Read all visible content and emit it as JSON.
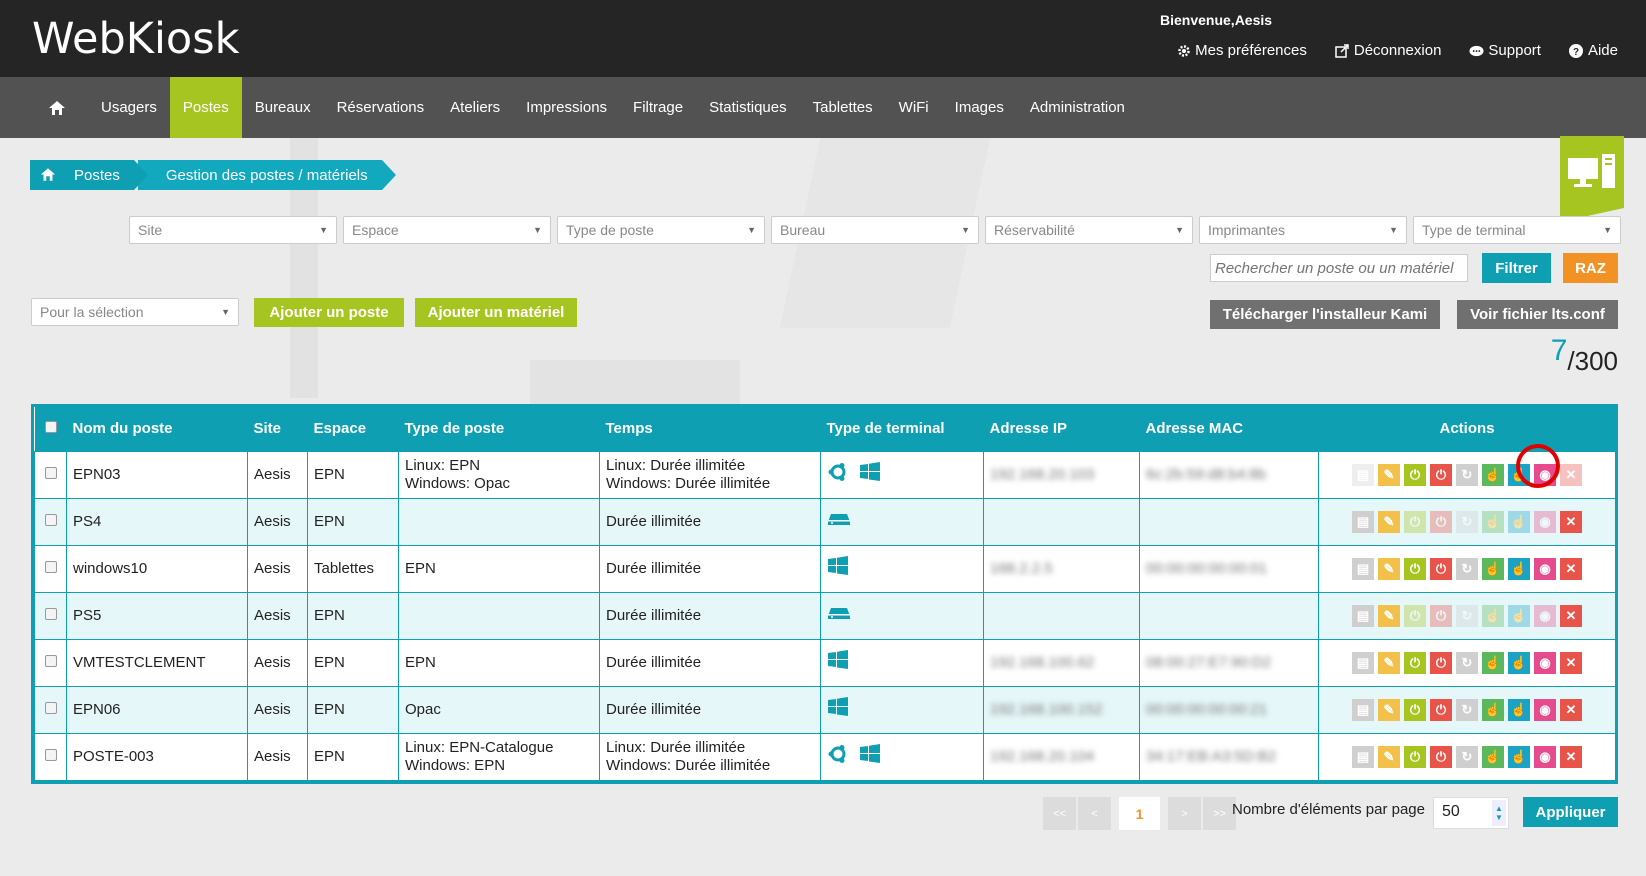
{
  "header": {
    "logo": "WebKiosk",
    "welcome": "Bienvenue,Aesis",
    "links": [
      {
        "label": "Mes préférences",
        "icon": "gear-icon"
      },
      {
        "label": "Déconnexion",
        "icon": "logout-icon"
      },
      {
        "label": "Support",
        "icon": "chat-icon"
      },
      {
        "label": "Aide",
        "icon": "help-icon"
      }
    ]
  },
  "nav": {
    "items": [
      "Usagers",
      "Postes",
      "Bureaux",
      "Réservations",
      "Ateliers",
      "Impressions",
      "Filtrage",
      "Statistiques",
      "Tablettes",
      "WiFi",
      "Images",
      "Administration"
    ],
    "active": "Postes"
  },
  "breadcrumb": {
    "home": "Postes",
    "current": "Gestion des postes / matériels"
  },
  "filters": {
    "selects": [
      "Site",
      "Espace",
      "Type de poste",
      "Bureau",
      "Réservabilité",
      "Imprimantes",
      "Type de terminal"
    ],
    "search_placeholder": "Rechercher un poste ou un matériel",
    "filter_button": "Filtrer",
    "reset_button": "RAZ"
  },
  "toolbar": {
    "selection_placeholder": "Pour la sélection",
    "add_post": "Ajouter un poste",
    "add_material": "Ajouter un matériel",
    "download_kami": "Télécharger l'installeur Kami",
    "view_lts": "Voir fichier lts.conf"
  },
  "counter": {
    "current": "7",
    "total": "/300"
  },
  "table": {
    "headers": [
      "Nom du poste",
      "Site",
      "Espace",
      "Type de poste",
      "Temps",
      "Type de terminal",
      "Adresse IP",
      "Adresse MAC",
      "Actions"
    ],
    "rows": [
      {
        "name": "EPN03",
        "site": "Aesis",
        "espace": "EPN",
        "type_l1": "Linux: EPN",
        "type_l2": "Windows: Opac",
        "temps_l1": "Linux: Durée illimitée",
        "temps_l2": "Windows: Durée illimitée",
        "terminal": [
          "linux",
          "windows"
        ],
        "ip": "192.168.20.103",
        "mac": "6c:2b:59:d8:b4:8b"
      },
      {
        "name": "PS4",
        "site": "Aesis",
        "espace": "EPN",
        "type_l1": "",
        "type_l2": "",
        "temps_l1": "Durée illimitée",
        "temps_l2": "",
        "terminal": [
          "device"
        ],
        "ip": "",
        "mac": ""
      },
      {
        "name": "windows10",
        "site": "Aesis",
        "espace": "Tablettes",
        "type_l1": "EPN",
        "type_l2": "",
        "temps_l1": "Durée illimitée",
        "temps_l2": "",
        "terminal": [
          "windows"
        ],
        "ip": "168.2.2.5",
        "mac": "00:00:00:00:00:01"
      },
      {
        "name": "PS5",
        "site": "Aesis",
        "espace": "EPN",
        "type_l1": "",
        "type_l2": "",
        "temps_l1": "Durée illimitée",
        "temps_l2": "",
        "terminal": [
          "device"
        ],
        "ip": "",
        "mac": ""
      },
      {
        "name": "VMTESTCLEMENT",
        "site": "Aesis",
        "espace": "EPN",
        "type_l1": "EPN",
        "type_l2": "",
        "temps_l1": "Durée illimitée",
        "temps_l2": "",
        "terminal": [
          "windows"
        ],
        "ip": "192.168.100.62",
        "mac": "08:00:27:E7:90:D2"
      },
      {
        "name": "EPN06",
        "site": "Aesis",
        "espace": "EPN",
        "type_l1": "Opac",
        "type_l2": "",
        "temps_l1": "Durée illimitée",
        "temps_l2": "",
        "terminal": [
          "windows"
        ],
        "ip": "192.168.100.152",
        "mac": "00:00:00:00:00:21"
      },
      {
        "name": "POSTE-003",
        "site": "Aesis",
        "espace": "EPN",
        "type_l1": "Linux: EPN-Catalogue",
        "type_l2": "Windows: EPN",
        "temps_l1": "Linux: Durée illimitée",
        "temps_l2": "Windows: Durée illimitée",
        "terminal": [
          "linux",
          "windows"
        ],
        "ip": "192.168.20.104",
        "mac": "34:17:EB:A3:5D:B2"
      }
    ],
    "action_colors": {
      "info": "#cfcfcf",
      "edit": "#f3c04a",
      "power_on": "#a7c520",
      "power_off": "#e8534a",
      "restart": "#cfcfcf",
      "wake": "#5cb85c",
      "connect": "#1ba3c6",
      "view": "#e64b8e",
      "delete": "#e8534a"
    }
  },
  "pagination": {
    "first": "<<",
    "prev": "<",
    "current": "1",
    "next": ">",
    "last": ">>",
    "per_page_label": "Nombre d'éléments par page",
    "per_page_value": "50",
    "apply": "Appliquer"
  }
}
